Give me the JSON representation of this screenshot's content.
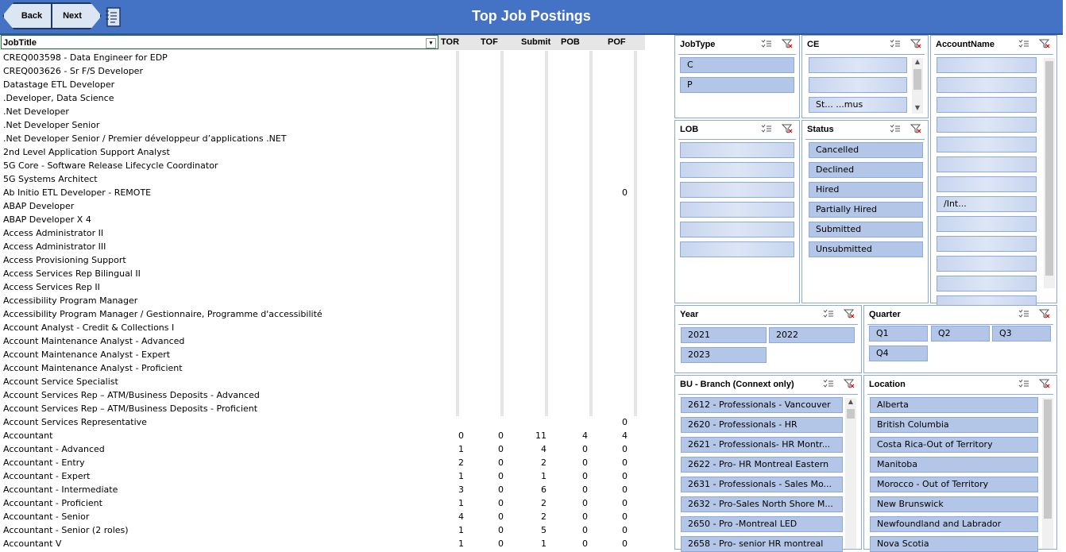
{
  "header": {
    "title": "Top Job Postings",
    "back_label": "Back",
    "next_label": "Next"
  },
  "table": {
    "columns": [
      "JobTitle",
      "TOR",
      "TOF",
      "Submit",
      "POB",
      "POF"
    ],
    "rows": [
      [
        "CREQ003598 - Data Engineer for EDP",
        "",
        "",
        "",
        "",
        ""
      ],
      [
        "CREQ003626 - Sr F/S Developer",
        "",
        "",
        "",
        "",
        ""
      ],
      [
        "Datastage ETL Developer",
        "",
        "",
        "",
        "",
        ""
      ],
      [
        ".Developer, Data Science",
        "",
        "",
        "",
        "",
        ""
      ],
      [
        ".Net Developer",
        "",
        "",
        "",
        "",
        ""
      ],
      [
        ".Net Developer Senior",
        "",
        "",
        "",
        "",
        ""
      ],
      [
        ".Net Developer Senior / Premier développeur d’applications .NET",
        "",
        "",
        "",
        "",
        ""
      ],
      [
        "2nd Level Application Support Analyst",
        "",
        "",
        "",
        "",
        ""
      ],
      [
        "5G Core - Software Release Lifecycle Coordinator",
        "",
        "",
        "",
        "",
        ""
      ],
      [
        "5G Systems Architect",
        "",
        "",
        "",
        "",
        ""
      ],
      [
        "Ab Initio ETL Developer - REMOTE",
        "",
        "",
        "",
        "",
        "0"
      ],
      [
        "ABAP Developer",
        "",
        "",
        "",
        "",
        ""
      ],
      [
        "ABAP Developer X 4",
        "",
        "",
        "",
        "",
        ""
      ],
      [
        "Access Administrator II",
        "",
        "",
        "",
        "",
        ""
      ],
      [
        "Access Administrator III",
        "",
        "",
        "",
        "",
        ""
      ],
      [
        "Access Provisioning Support",
        "",
        "",
        "",
        "",
        ""
      ],
      [
        "Access Services Rep Bilingual II",
        "",
        "",
        "",
        "",
        ""
      ],
      [
        "Access Services Rep II",
        "",
        "",
        "",
        "",
        ""
      ],
      [
        "Accessibility Program Manager",
        "",
        "",
        "",
        "",
        ""
      ],
      [
        "Accessibility Program Manager  / Gestionnaire, Programme d'accessibilité",
        "",
        "",
        "",
        "",
        ""
      ],
      [
        "Account Analyst - Credit & Collections I",
        "",
        "",
        "",
        "",
        ""
      ],
      [
        "Account Maintenance Analyst - Advanced",
        "",
        "",
        "",
        "",
        ""
      ],
      [
        "Account Maintenance Analyst - Expert",
        "",
        "",
        "",
        "",
        ""
      ],
      [
        "Account Maintenance Analyst - Proficient",
        "",
        "",
        "",
        "",
        ""
      ],
      [
        "Account Service Specialist",
        "",
        "",
        "",
        "",
        ""
      ],
      [
        "Account Services Rep – ATM/Business Deposits - Advanced",
        "",
        "",
        "",
        "",
        ""
      ],
      [
        "Account Services Rep – ATM/Business Deposits - Proficient",
        "",
        "",
        "",
        "",
        ""
      ],
      [
        "Account Services Representative",
        "",
        "",
        "",
        "",
        "0"
      ],
      [
        "Accountant",
        "0",
        "0",
        "11",
        "4",
        "4"
      ],
      [
        "Accountant - Advanced",
        "1",
        "0",
        "4",
        "0",
        "0"
      ],
      [
        "Accountant - Entry",
        "2",
        "0",
        "2",
        "0",
        "0"
      ],
      [
        "Accountant - Expert",
        "1",
        "0",
        "1",
        "0",
        "0"
      ],
      [
        "Accountant - Intermediate",
        "3",
        "0",
        "6",
        "0",
        "0"
      ],
      [
        "Accountant - Proficient",
        "1",
        "0",
        "2",
        "0",
        "0"
      ],
      [
        "Accountant - Senior",
        "4",
        "0",
        "2",
        "0",
        "0"
      ],
      [
        "Accountant - Senior (2 roles)",
        "1",
        "0",
        "5",
        "0",
        "0"
      ],
      [
        "Accountant V",
        "1",
        "0",
        "1",
        "0",
        "0"
      ]
    ]
  },
  "slicers": {
    "jobtype": {
      "title": "JobType",
      "items": [
        "C",
        "P"
      ]
    },
    "ce": {
      "title": "CE",
      "items": [
        "",
        "",
        "St... ...mus"
      ]
    },
    "accountname": {
      "title": "AccountName",
      "items": [
        "",
        "",
        "",
        "",
        "",
        "",
        "",
        "/Int...",
        "",
        "",
        "",
        "",
        ""
      ]
    },
    "lob": {
      "title": "LOB",
      "items": [
        "",
        "",
        "",
        "",
        "",
        ""
      ]
    },
    "status": {
      "title": "Status",
      "items": [
        "Cancelled",
        "Declined",
        "Hired",
        "Partially Hired",
        "Submitted",
        "Unsubmitted"
      ]
    },
    "year": {
      "title": "Year",
      "items": [
        "2021",
        "2022",
        "2023"
      ]
    },
    "quarter": {
      "title": "Quarter",
      "items": [
        "Q1",
        "Q2",
        "Q3",
        "Q4"
      ]
    },
    "bu_branch": {
      "title": "BU - Branch (Connext only)",
      "items": [
        "2612 - Professionals - Vancouver",
        "2620 - Professionals - HR",
        "2621 - Professionals- HR Montr...",
        "2622 - Pro- HR Montreal Eastern",
        "2631 - Professionals - Sales Mo...",
        "2632 - Pro-Sales North Shore M...",
        "2650 - Pro -Montreal LED",
        "2658 - Pro- senior HR montreal"
      ]
    },
    "location": {
      "title": "Location",
      "items": [
        "Alberta",
        "British Columbia",
        "Costa Rica-Out of Territory",
        "Manitoba",
        "Morocco - Out of Territory",
        "New Brunswick",
        "Newfoundland and Labrador",
        "Nova Scotia"
      ]
    }
  },
  "colors": {
    "banner": "#4472C4",
    "slicer_item": "#B4C6E7",
    "slicer_border": "#8EA9DB",
    "header_border": "#217346"
  }
}
